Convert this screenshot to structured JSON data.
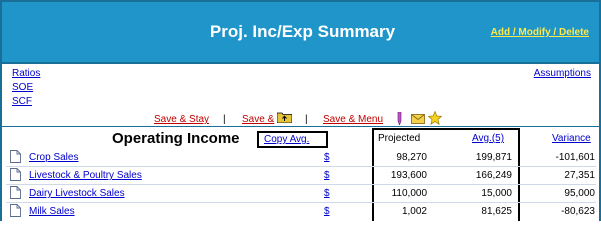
{
  "header": {
    "title": "Proj. Inc/Exp Summary",
    "action_link": "Add / Modify / Delete",
    "bg_color": "#1f95c9",
    "link_color": "#ffe94a"
  },
  "nav": {
    "links": [
      "Ratios",
      "SOE",
      "SCF"
    ],
    "assumptions": "Assumptions"
  },
  "save_bar": {
    "save_stay": "Save & Stay",
    "save_folder": "Save &",
    "save_menu": "Save & Menu",
    "separator": "|",
    "icons": [
      "folder-up-icon",
      "pencil-icon",
      "mail-icon",
      "star-icon"
    ]
  },
  "section": {
    "title": "Operating Income",
    "copy_avg": "Copy Avg."
  },
  "columns": {
    "projected": "Projected",
    "avg": "Avg.(5)",
    "variance": "Variance"
  },
  "rows": [
    {
      "label": "Crop Sales",
      "dollar": "$",
      "projected": "98,270",
      "avg": "199,871",
      "variance": "-101,601"
    },
    {
      "label": "Livestock & Poultry Sales",
      "dollar": "$",
      "projected": "193,600",
      "avg": "166,249",
      "variance": "27,351"
    },
    {
      "label": "Dairy Livestock Sales",
      "dollar": "$",
      "projected": "110,000",
      "avg": "15,000",
      "variance": "95,000"
    },
    {
      "label": "Milk Sales",
      "dollar": "$",
      "projected": "1,002",
      "avg": "81,625",
      "variance": "-80,623"
    }
  ]
}
